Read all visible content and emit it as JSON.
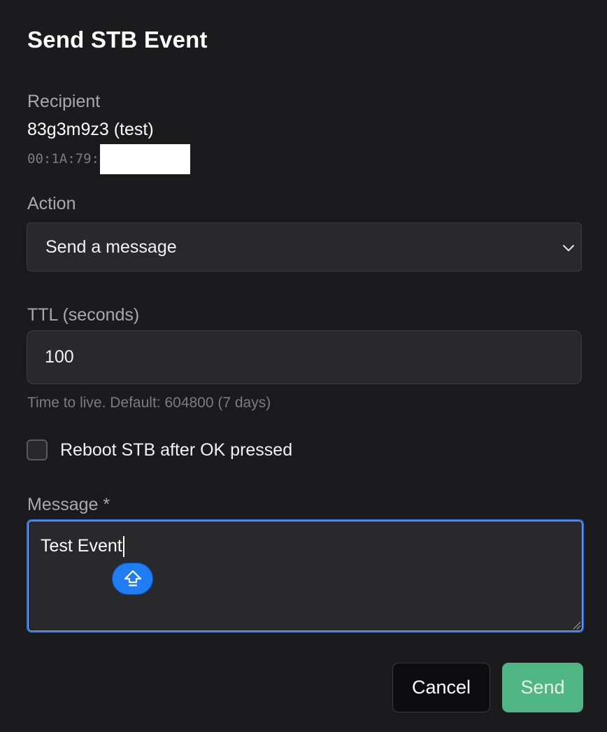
{
  "dialog": {
    "title": "Send STB Event"
  },
  "recipient": {
    "label": "Recipient",
    "name": "83g3m9z3 (test)",
    "mac_prefix": "00:1A:79:"
  },
  "action": {
    "label": "Action",
    "selected": "Send a message"
  },
  "ttl": {
    "label": "TTL (seconds)",
    "value": "100",
    "help": "Time to live. Default: 604800 (7 days)"
  },
  "reboot": {
    "label": "Reboot STB after OK pressed",
    "checked": false
  },
  "message": {
    "label": "Message *",
    "value": "Test Event"
  },
  "buttons": {
    "cancel": "Cancel",
    "send": "Send"
  },
  "colors": {
    "background": "#1b1b1d",
    "field": "#29292c",
    "focus_border": "#2f6fe0",
    "send_button": "#4fb583",
    "ime_button": "#1f7cf2"
  },
  "icons": {
    "select_arrow": "chevron-down-icon",
    "ime": "shift-arrow-icon",
    "resize": "resize-grip-icon"
  }
}
